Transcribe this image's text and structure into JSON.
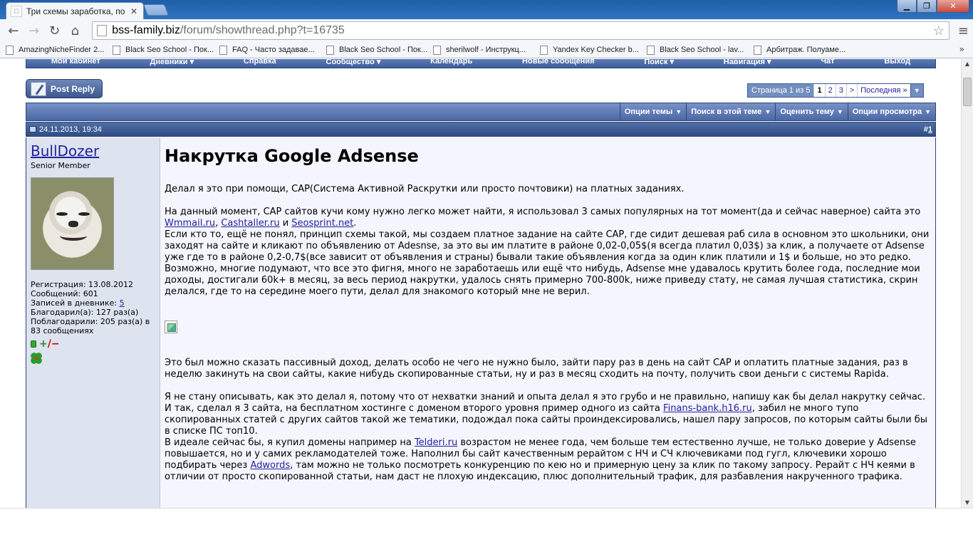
{
  "browser": {
    "tab_title": "Три схемы заработка, по к",
    "tab_close": "✕",
    "window_controls": [
      "▁",
      "❐",
      "✕"
    ],
    "url_host": "bss-family.biz",
    "url_path": "/forum/showthread.php?t=16735",
    "nav": {
      "back": "←",
      "forward": "→",
      "reload": "↻",
      "home": "⌂",
      "star": "☆",
      "menu": "≡"
    },
    "bookmarks": [
      "AmazingNicheFinder 2...",
      "Black Seo School - Пок...",
      "FAQ - Часто задавае...",
      "Black Seo School - Пок...",
      "sherilwolf - Инструкц...",
      "Yandex Key Checker b...",
      "Black Seo School - lav...",
      "Арбитраж. Полуаме..."
    ],
    "bookmarks_more": "»"
  },
  "forum": {
    "navbar": [
      "Мой кабинет",
      "Дневники ▾",
      "Справка",
      "Сообщество ▾",
      "Календарь",
      "Новые сообщения",
      "Поиск ▾",
      "Навигация ▾",
      "Чат",
      "Выход"
    ],
    "post_reply": "Post Reply",
    "pagination": {
      "info": "Страница 1 из 5",
      "pages": [
        "1",
        "2",
        "3"
      ],
      "next": ">",
      "last": "Последняя »",
      "drop": "▼"
    },
    "thread_tools": [
      "Опции темы",
      "Поиск в этой теме",
      "Оценить тему",
      "Опции просмотра"
    ],
    "post": {
      "date": "24.11.2013, 19:34",
      "number_prefix": "#",
      "number": "1"
    },
    "user": {
      "name": "BullDozer",
      "title": "Senior Member",
      "reg": "Регистрация: 13.08.2012",
      "messages": "Сообщений: 601",
      "diary_label": "Записей в дневнике: ",
      "diary_count": "5",
      "thanked": "Благодарил(а): 127 раз(а)",
      "thanked_by": "Поблагодарили: 205 раз(а) в 83 сообщениях",
      "rep_plus": "+",
      "rep_minus": "/−"
    },
    "content": {
      "title": "Накрутка Google Adsense",
      "p1": "Делал я это при помощи, САР(Система Активной Раскрутки или просто почтовики) на платных заданиях.",
      "p2_a": "На данный момент, САР сайтов кучи кому нужно легко может найти, я использовал 3 самых популярных на тот момент(да и сейчас наверное) сайта это ",
      "link_wmmail": "Wmmail.ru",
      "sep1": ", ",
      "link_cashtaller": "Cashtaller.ru",
      "sep2": " и ",
      "link_seosprint": "Seosprint.net",
      "p2_end": ".",
      "p3": "Если кто то, ещё не понял, принцип схемы такой, мы создаем платное задание на сайте САР, где сидит дешевая раб сила в основном это школьники, они заходят на сайте и кликают по объявлению от Adesnse, за это вы им платите в районе 0,02-0,05$(я всегда платил 0,03$) за клик, а получаете от Adsense уже где то в районе 0,2-0,7$(все зависит от объявления и страны) бывали такие объявления когда за один клик платили и 1$ и больше, но это редко.",
      "p4": "Возможно, многие подумают, что все это фигня, много не заработаешь или ещё что нибудь, Adsense мне удавалось крутить более года, последние мои доходы, достигали 60k+ в месяц, за весь период накрутки, удалось снять примерно 700-800k, ниже приведу стату, не самая лучшая статистика, скрин делался, где то на середине моего пути, делал для знакомого который мне не верил.",
      "p5": "Это был можно сказать пассивный доход, делать особо не чего не нужно было, зайти пару раз в день на сайт САР и оплатить платные задания, раз в неделю закинуть на свои сайты, какие нибудь скопированные статьи, ну и раз в месяц сходить на почту, получить свои деньги с системы Rapida.",
      "p6_a": "Я не стану описывать, как это делал я, потому что от нехватки знаний и опыта делал я это грубо и не правильно, напишу как бы делал накрутку сейчас. И так, сделал я 3 сайта, на бесплатном хостинге с доменом второго уровня пример одного из сайта ",
      "link_finans": "Finans-bank.h16.ru",
      "p6_b": ", забил не много тупо скопированных статей с других сайтов такой же тематики, подождал пока сайты проиндексировались, нашел пару запросов, по которым сайты были бы в списке ПС топ10.",
      "p7_a": "В идеале сейчас бы, я купил домены например на ",
      "link_telderi": "Telderi.ru",
      "p7_b": " возрастом не менее года, чем больше тем естественно лучше, не только доверие у Adsense повышается, но и у самих рекламодателей тоже. Наполнил бы сайт качественным рерайтом с НЧ и СЧ ключевиками под гугл, ключевики хорошо подбирать через ",
      "link_adwords": "Adwords",
      "p7_c": ", там можно не только посмотреть конкуренцию по кею но и примерную цену за клик по такому запросу. Рерайт с НЧ кеями в отличии от просто скопированной статьи, нам даст не плохую индексацию, плюс дополнительный трафик, для разбавления накрученного трафика."
    }
  },
  "colors": {
    "nav_blue": "#3e5d9c",
    "link": "#22229c",
    "post_bg": "#f5f5ff",
    "user_bg": "#dde3ef"
  }
}
